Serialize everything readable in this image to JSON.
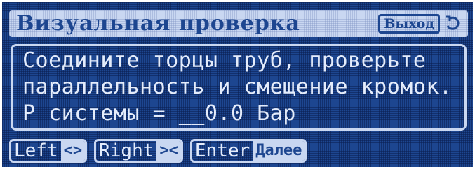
{
  "title_bar": {
    "title": "Визуальная проверка",
    "exit_label": "Выход",
    "exit_icon": "return-arrow-icon"
  },
  "message": {
    "line1": "Соедините торцы труб, проверьте",
    "line2": "параллельность и смещение кромок.",
    "line3": "Р системы = __0.0 Бар"
  },
  "footer": {
    "left": {
      "name": "Left",
      "hint": "<>"
    },
    "right": {
      "name": "Right",
      "hint": "><"
    },
    "enter": {
      "name": "Enter",
      "hint": "Далее"
    }
  },
  "colors": {
    "background": "#1d4690",
    "foreground": "#c9d7f1"
  }
}
